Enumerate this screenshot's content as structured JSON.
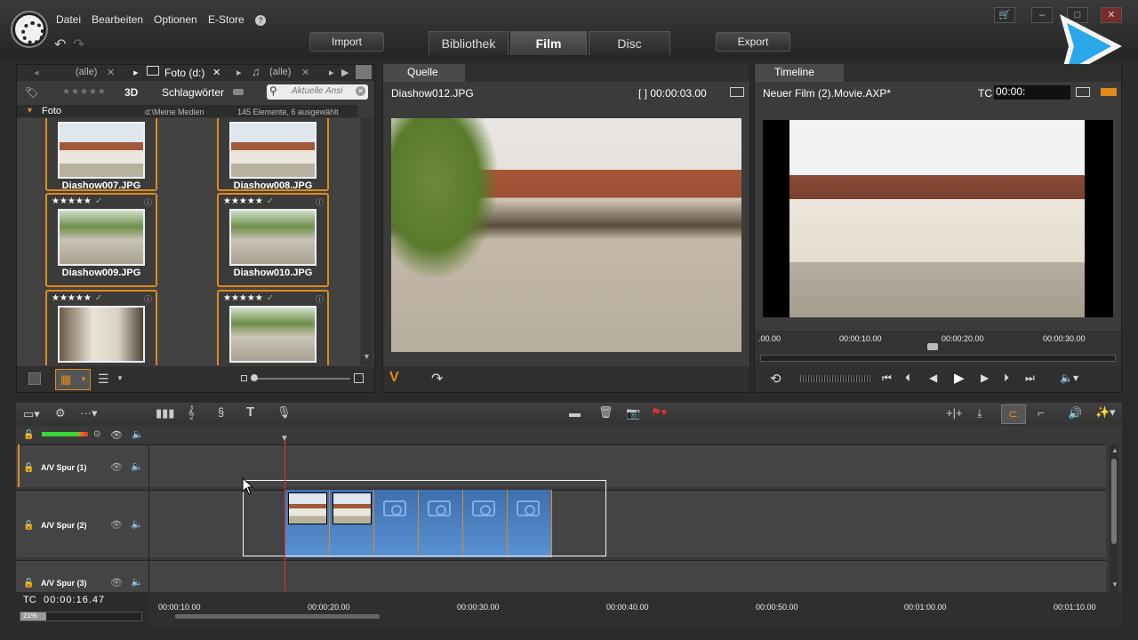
{
  "menu": {
    "file": "Datei",
    "edit": "Bearbeiten",
    "options": "Optionen",
    "store": "E-Store",
    "help": "?"
  },
  "toolbar": {
    "import": "Import",
    "export": "Export"
  },
  "tabs": {
    "library": "Bibliothek",
    "movie": "Film",
    "disc": "Disc"
  },
  "library": {
    "tab_all_1": "(alle)",
    "tab_foto": "Foto (d:)",
    "tab_all_2": "(alle)",
    "stars": "★★★★★",
    "threed": "3D",
    "keywords": "Schlagwörter",
    "search_placeholder": "Aktuelle Ansi",
    "folder_label": "Foto",
    "folder_path": "d:\\Meine Medien",
    "count": "145 Elemente, 6 ausgewählt",
    "items": [
      {
        "name": "Diashow007.JPG",
        "stars": ""
      },
      {
        "name": "Diashow008.JPG",
        "stars": ""
      },
      {
        "name": "Diashow009.JPG",
        "stars": "★★★★★"
      },
      {
        "name": "Diashow010.JPG",
        "stars": "★★★★★"
      },
      {
        "name": "",
        "stars": "★★★★★"
      },
      {
        "name": "",
        "stars": "★★★★★"
      }
    ]
  },
  "source": {
    "tab": "Quelle",
    "file": "Diashow012.JPG",
    "duration": "[ ] 00:00:03.00"
  },
  "timeline_preview": {
    "tab": "Timeline",
    "title": "Neuer Film (2).Movie.AXP*",
    "tc_label": "TC",
    "tc_value": "00:00:",
    "ruler": [
      ".00.00",
      "00:00:10.00",
      "00:00:20.00",
      "00:00:30.00"
    ]
  },
  "tracks": [
    {
      "name": "A/V Spur (1)"
    },
    {
      "name": "A/V Spur (2)"
    },
    {
      "name": "A/V Spur (3)"
    }
  ],
  "timecode": {
    "label": "TC",
    "value": "00:00:16.47",
    "zoom": "21%"
  },
  "ruler": [
    "00:00:10.00",
    "00:00:20.00",
    "00:00:30.00",
    "00:00:40.00",
    "00:00:50.00",
    "00:01:00.00",
    "00:01:10.00"
  ],
  "colors": {
    "accent": "#e08a1c",
    "playhead": "#e03030",
    "clip": "#4a84c8",
    "play_logo": "#2aa6ea"
  }
}
